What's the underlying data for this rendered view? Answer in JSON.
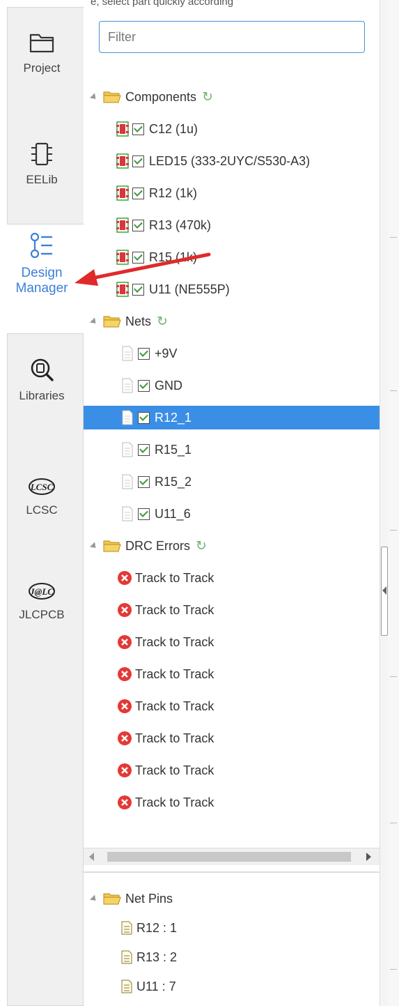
{
  "top_hint": "e, select part quickly according",
  "nav": {
    "items": [
      {
        "label": "Project",
        "icon": "folder-outline-icon"
      },
      {
        "label": "EELib",
        "icon": "chip-icon"
      },
      {
        "label": "Design\nManager",
        "label_line1": "Design",
        "label_line2": "Manager",
        "icon": "list-icon",
        "active": true
      },
      {
        "label": "Libraries",
        "icon": "library-search-icon"
      },
      {
        "label": "LCSC",
        "icon": "lcsc-logo"
      },
      {
        "label": "JLCPCB",
        "icon": "jlc-logo"
      }
    ]
  },
  "filter": {
    "placeholder": "Filter",
    "value": ""
  },
  "tree": {
    "components": {
      "label": "Components",
      "items": [
        "C12 (1u)",
        "LED15 (333-2UYC/S530-A3)",
        "R12 (1k)",
        "R13 (470k)",
        "R15 (1k)",
        "U11 (NE555P)"
      ]
    },
    "nets": {
      "label": "Nets",
      "items": [
        "+9V",
        "GND",
        "R12_1",
        "R15_1",
        "R15_2",
        "U11_6"
      ],
      "selected": "R12_1"
    },
    "drc": {
      "label": "DRC Errors",
      "items": [
        "Track to Track",
        "Track to Track",
        "Track to Track",
        "Track to Track",
        "Track to Track",
        "Track to Track",
        "Track to Track",
        "Track to Track"
      ]
    }
  },
  "net_pins": {
    "label": "Net Pins",
    "items": [
      "R12 : 1",
      "R13 : 2",
      "U11 : 7"
    ]
  },
  "colors": {
    "accent": "#3a8ee6",
    "active_nav": "#3c7fd8",
    "arrow": "#e02a2a",
    "error": "#e53935",
    "refresh": "#6fb36f"
  }
}
